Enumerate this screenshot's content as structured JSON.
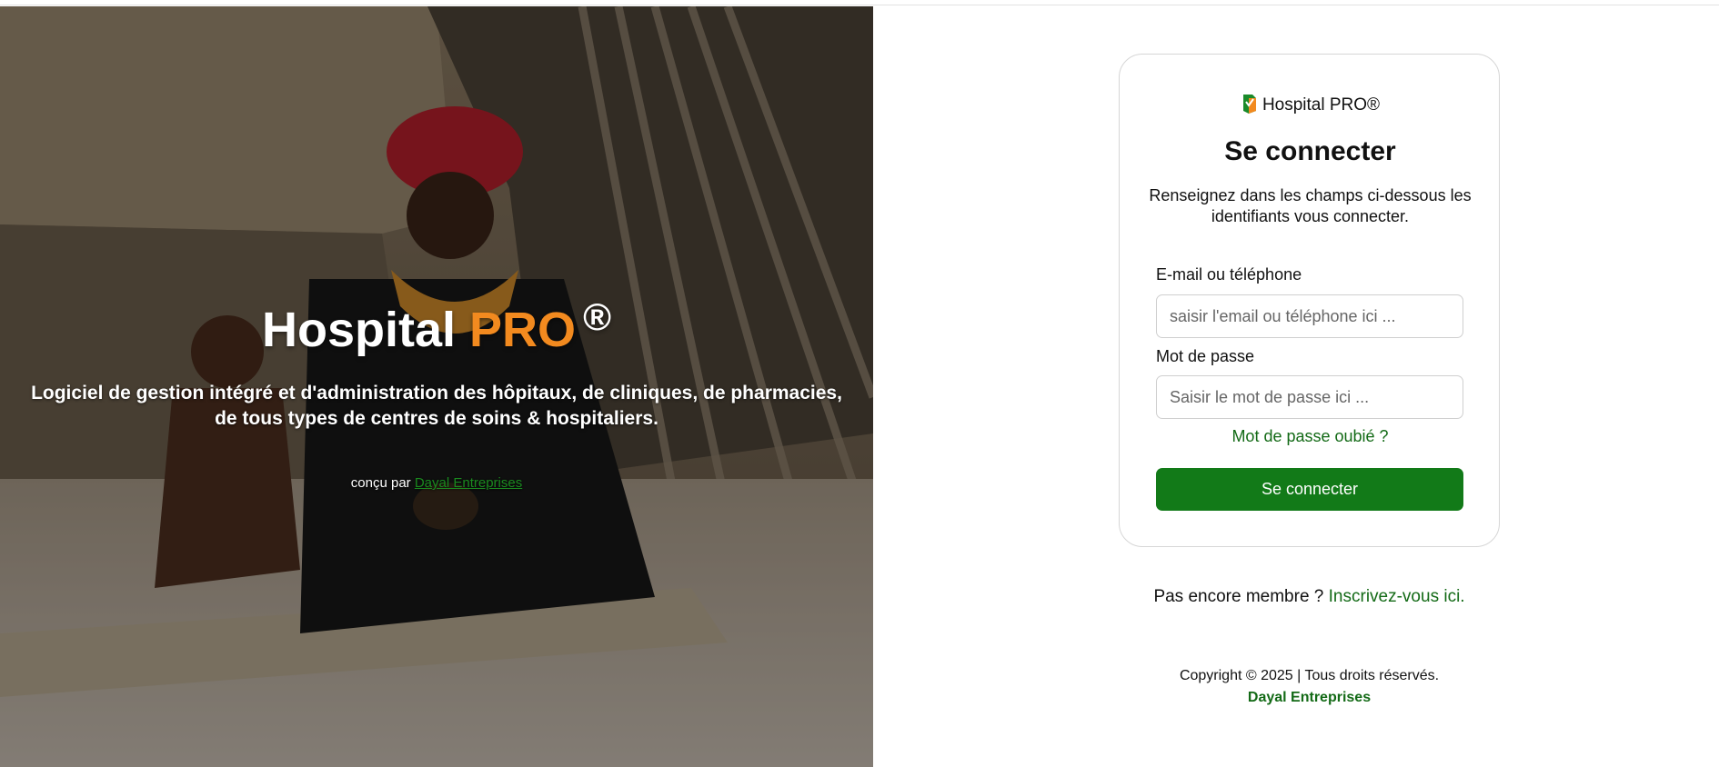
{
  "colors": {
    "brand_green": "#127a18",
    "brand_orange": "#f28a1f"
  },
  "hero": {
    "title_main": "Hospital",
    "title_accent": "PRO",
    "title_mark": "®",
    "description": "Logiciel de gestion intégré et d'administration des hôpitaux, de cliniques, de pharmacies, de tous types de centres de soins & hospitaliers.",
    "credit_prefix": "conçu par",
    "credit_link": "Dayal Entreprises"
  },
  "card": {
    "brand": "Hospital PRO®",
    "brand_icon": "hospital-pro-logo-icon",
    "title": "Se connecter",
    "subtitle": "Renseignez dans les champs ci-dessous les identifiants vous connecter.",
    "email_label": "E-mail ou téléphone",
    "email_placeholder": "saisir l'email ou téléphone ici ...",
    "password_label": "Mot de passe",
    "password_placeholder": "Saisir le mot de passe ici ...",
    "forgot_link": "Mot de passe oubié ?",
    "submit_label": "Se connecter"
  },
  "signup": {
    "prefix": "Pas encore membre ?",
    "link": "Inscrivez-vous ici."
  },
  "footer": {
    "copyright": "Copyright © 2025 | Tous droits réservés.",
    "company": "Dayal Entreprises"
  }
}
